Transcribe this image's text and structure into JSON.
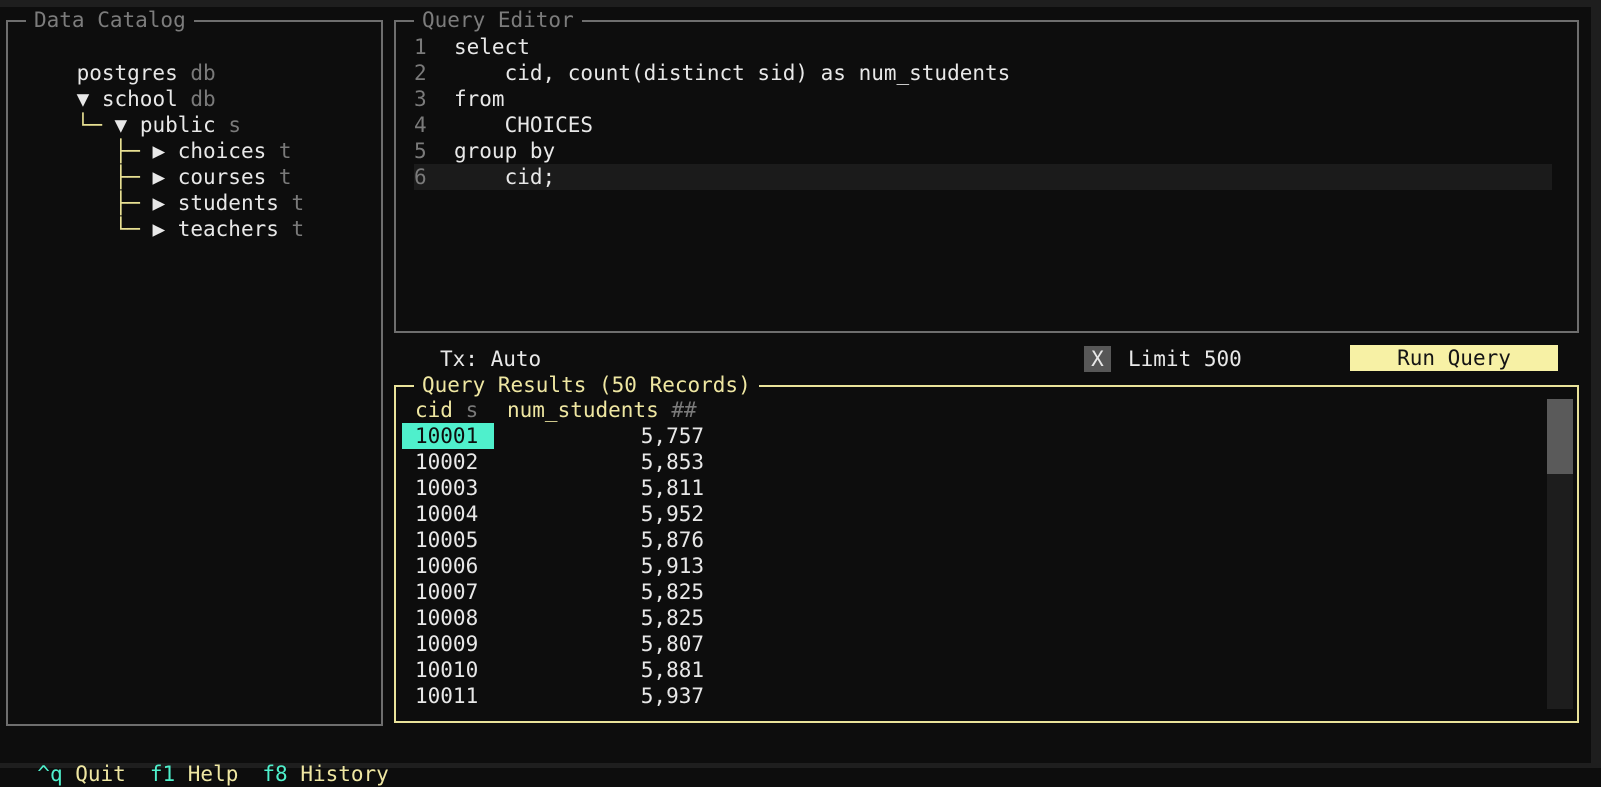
{
  "catalog": {
    "title": "Data Catalog",
    "tree": [
      {
        "guide": "",
        "arrow": "",
        "label": "postgres",
        "tag": "db"
      },
      {
        "guide": "",
        "arrow": "▼ ",
        "label": "school",
        "tag": "db"
      },
      {
        "guide": "└─ ",
        "arrow": "▼ ",
        "label": "public",
        "tag": "s"
      },
      {
        "guide": "   ├─ ",
        "arrow": "▶ ",
        "label": "choices",
        "tag": "t"
      },
      {
        "guide": "   ├─ ",
        "arrow": "▶ ",
        "label": "courses",
        "tag": "t"
      },
      {
        "guide": "   ├─ ",
        "arrow": "▶ ",
        "label": "students",
        "tag": "t"
      },
      {
        "guide": "   └─ ",
        "arrow": "▶ ",
        "label": "teachers",
        "tag": "t"
      }
    ]
  },
  "editor": {
    "title": "Query Editor",
    "lines": [
      {
        "n": "1",
        "text": "select"
      },
      {
        "n": "2",
        "text": "    cid, count(distinct sid) as num_students"
      },
      {
        "n": "3",
        "text": "from"
      },
      {
        "n": "4",
        "text": "    CHOICES"
      },
      {
        "n": "5",
        "text": "group by"
      },
      {
        "n": "6",
        "text": "    cid;"
      }
    ]
  },
  "controls": {
    "tx": "Tx: Auto",
    "limit_checkbox": "X",
    "limit_label": "Limit 500",
    "run_button": "Run Query"
  },
  "results": {
    "title": "Query Results (50 Records)",
    "columns": [
      {
        "name": "cid",
        "type": "s"
      },
      {
        "name": "num_students",
        "type": "##"
      }
    ],
    "rows": [
      {
        "cid": "10001",
        "num_students": "5,757"
      },
      {
        "cid": "10002",
        "num_students": "5,853"
      },
      {
        "cid": "10003",
        "num_students": "5,811"
      },
      {
        "cid": "10004",
        "num_students": "5,952"
      },
      {
        "cid": "10005",
        "num_students": "5,876"
      },
      {
        "cid": "10006",
        "num_students": "5,913"
      },
      {
        "cid": "10007",
        "num_students": "5,825"
      },
      {
        "cid": "10008",
        "num_students": "5,825"
      },
      {
        "cid": "10009",
        "num_students": "5,807"
      },
      {
        "cid": "10010",
        "num_students": "5,881"
      },
      {
        "cid": "10011",
        "num_students": "5,937"
      }
    ]
  },
  "footer": [
    {
      "key": "^q",
      "label": "Quit"
    },
    {
      "key": "f1",
      "label": "Help"
    },
    {
      "key": "f8",
      "label": "History"
    }
  ],
  "colors": {
    "accent_teal": "#4ff0cc",
    "accent_yellow": "#efe7a2",
    "border_gray": "#6e6e6e"
  }
}
